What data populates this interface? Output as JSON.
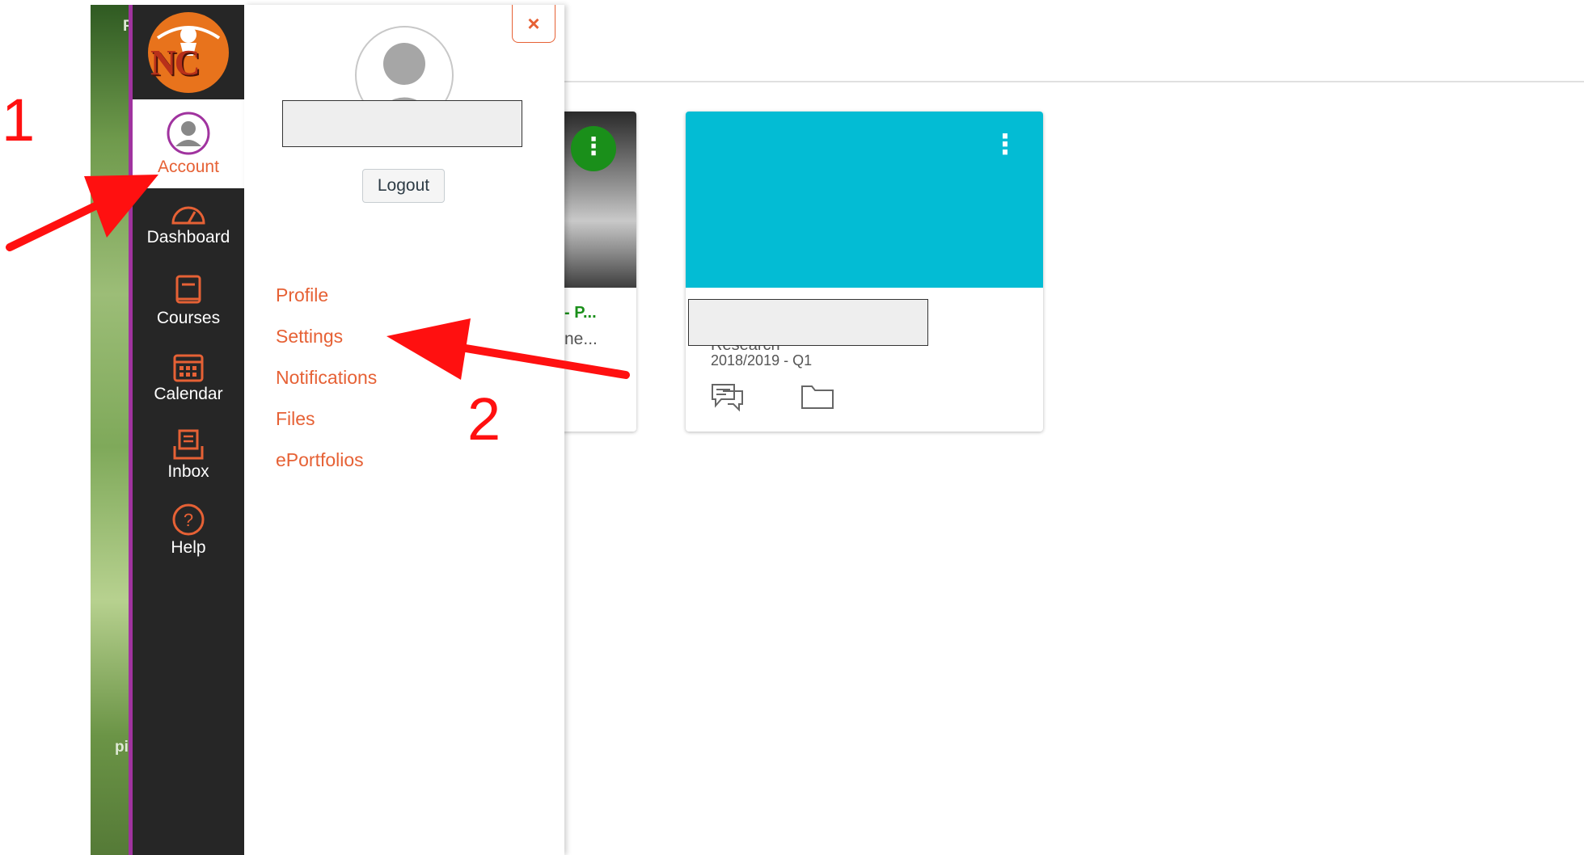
{
  "background": {
    "letter_top": "F",
    "letter_bottom": "pi"
  },
  "global_nav": {
    "logo_text": "NC",
    "items": [
      {
        "label": "Account",
        "icon": "avatar-icon"
      },
      {
        "label": "Dashboard",
        "icon": "dashboard-icon"
      },
      {
        "label": "Courses",
        "icon": "courses-icon"
      },
      {
        "label": "Calendar",
        "icon": "calendar-icon"
      },
      {
        "label": "Inbox",
        "icon": "inbox-icon"
      },
      {
        "label": "Help",
        "icon": "help-icon"
      }
    ],
    "accent_color": "#e66135",
    "border_color": "#a0339f"
  },
  "account_tray": {
    "close_label": "×",
    "logout_label": "Logout",
    "links": [
      "Profile",
      "Settings",
      "Notifications",
      "Files",
      "ePortfolios"
    ]
  },
  "courses": [
    {
      "title_fragment": "- P...",
      "subtitle_fragment": "ne...",
      "menu_label": "⋮",
      "color": "#1a8f1a"
    },
    {
      "title_fragment": "Research",
      "term": "2018/2019 - Q1",
      "menu_label": "⋮",
      "color": "#03bcd4"
    }
  ],
  "annotations": {
    "step1": "1",
    "step2": "2",
    "color": "#ff1010"
  }
}
